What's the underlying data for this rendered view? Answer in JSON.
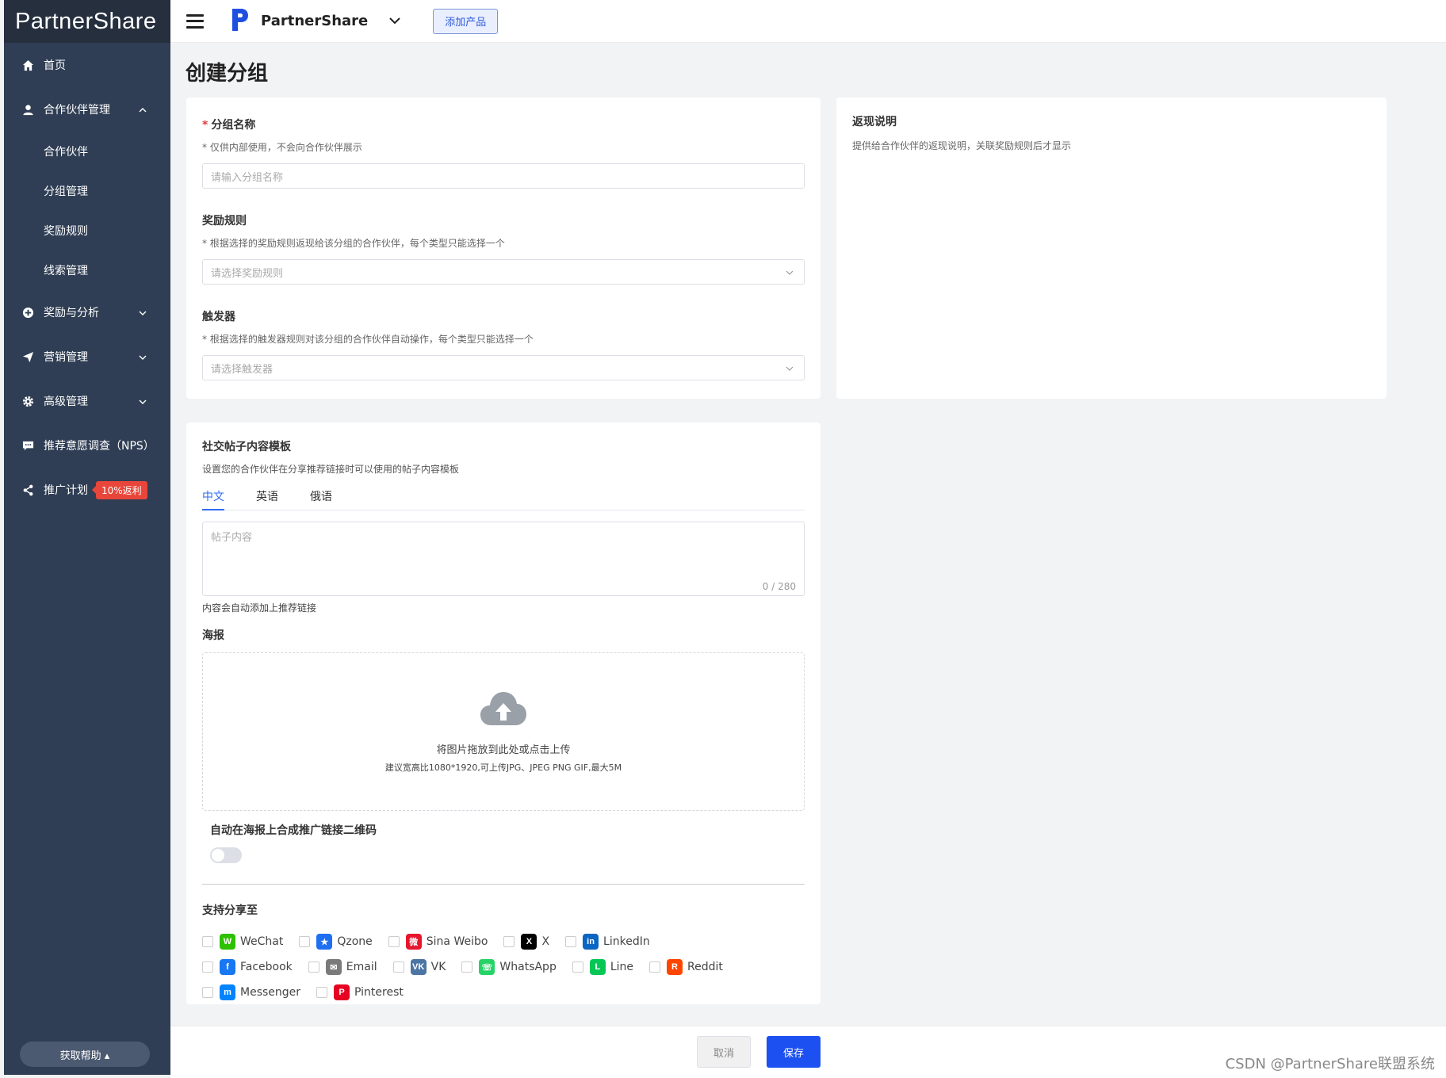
{
  "sidebar": {
    "logo": "PartnerShare",
    "items": [
      {
        "label": "首页",
        "icon": "home-icon"
      },
      {
        "label": "合作伙伴管理",
        "icon": "user-icon"
      },
      {
        "label": "奖励与分析",
        "icon": "reward-icon"
      },
      {
        "label": "营销管理",
        "icon": "send-icon"
      },
      {
        "label": "高级管理",
        "icon": "gear-icon"
      },
      {
        "label": "推荐意愿调查（NPS）",
        "icon": "chat-icon"
      },
      {
        "label": "推广计划",
        "icon": "share-icon"
      }
    ],
    "sub_items": [
      "合作伙伴",
      "分组管理",
      "奖励规则",
      "线索管理"
    ],
    "promo_badge": "10%返利",
    "help": "获取帮助 ▴"
  },
  "header": {
    "brand": "PartnerShare",
    "add_product": "添加产品"
  },
  "page": {
    "title": "创建分组"
  },
  "form": {
    "group_name": {
      "label": "分组名称",
      "hint": "* 仅供内部使用，不会向合作伙伴展示",
      "placeholder": "请输入分组名称"
    },
    "reward_rule": {
      "label": "奖励规则",
      "hint": "* 根据选择的奖励规则返现给该分组的合作伙伴，每个类型只能选择一个",
      "placeholder": "请选择奖励规则"
    },
    "trigger": {
      "label": "触发器",
      "hint": "* 根据选择的触发器规则对该分组的合作伙伴自动操作，每个类型只能选择一个",
      "placeholder": "请选择触发器"
    }
  },
  "cashback": {
    "title": "返现说明",
    "desc": "提供给合作伙伴的返现说明，关联奖励规则后才显示"
  },
  "social": {
    "title": "社交帖子内容模板",
    "desc": "设置您的合作伙伴在分享推荐链接时可以使用的帖子内容模板",
    "tabs": [
      "中文",
      "英语",
      "俄语"
    ],
    "content_placeholder": "帖子内容",
    "counter": "0 / 280",
    "auto_link_note": "内容会自动添加上推荐链接",
    "poster_label": "海报",
    "upload_text": "将图片拖放到此处或点击上传",
    "upload_hint": "建议宽高比1080*1920,可上传JPG、JPEG PNG GIF,最大5M",
    "qr_label": "自动在海报上合成推广链接二维码",
    "share_label": "支持分享至",
    "platforms": [
      [
        "WeChat",
        "Qzone",
        "Sina Weibo",
        "X",
        "LinkedIn"
      ],
      [
        "Facebook",
        "Email",
        "VK",
        "WhatsApp",
        "Line",
        "Reddit"
      ],
      [
        "Messenger",
        "Pinterest"
      ]
    ],
    "platform_colors": {
      "WeChat": "#2dc100",
      "Qzone": "#1e6ff1",
      "Sina Weibo": "#e6162d",
      "X": "#000000",
      "LinkedIn": "#0a66c2",
      "Facebook": "#1877f2",
      "Email": "#7a7a7a",
      "VK": "#4c75a3",
      "WhatsApp": "#25d366",
      "Line": "#06c755",
      "Reddit": "#ff4500",
      "Messenger": "#0084ff",
      "Pinterest": "#e60023"
    }
  },
  "footer": {
    "cancel": "取消",
    "save": "保存",
    "watermark": "CSDN @PartnerShare联盟系统"
  }
}
